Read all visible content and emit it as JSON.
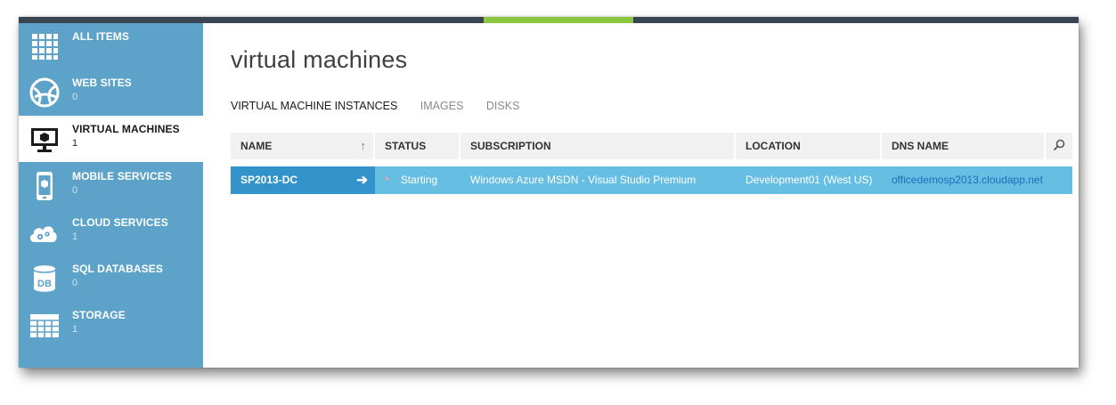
{
  "sidebar": {
    "items": [
      {
        "label": "ALL ITEMS",
        "count": "",
        "icon": "grid-icon"
      },
      {
        "label": "WEB SITES",
        "count": "0",
        "icon": "globe-icon"
      },
      {
        "label": "VIRTUAL MACHINES",
        "count": "1",
        "icon": "monitor-icon"
      },
      {
        "label": "MOBILE SERVICES",
        "count": "0",
        "icon": "phone-icon"
      },
      {
        "label": "CLOUD SERVICES",
        "count": "1",
        "icon": "cloud-gear-icon"
      },
      {
        "label": "SQL DATABASES",
        "count": "0",
        "icon": "database-icon"
      },
      {
        "label": "STORAGE",
        "count": "1",
        "icon": "table-icon"
      }
    ],
    "active_index": 2
  },
  "main": {
    "title": "virtual machines",
    "tabs": [
      {
        "label": "VIRTUAL MACHINE INSTANCES",
        "active": true
      },
      {
        "label": "IMAGES",
        "active": false
      },
      {
        "label": "DISKS",
        "active": false
      }
    ]
  },
  "grid": {
    "columns": [
      "NAME",
      "STATUS",
      "SUBSCRIPTION",
      "LOCATION",
      "DNS NAME"
    ],
    "sort_indicator": "↑",
    "rows": [
      {
        "name": "SP2013-DC",
        "status": "Starting",
        "subscription": "Windows Azure MSDN - Visual Studio Premium",
        "location": "Development01 (West US)",
        "dns_name": "officedemosp2013.cloudapp.net"
      }
    ]
  },
  "colors": {
    "sidebar_bg": "#5da3c9",
    "row_selected": "#67bee3",
    "row_name_cell": "#3193c9",
    "accent_green": "#8cc63e",
    "link": "#1c6fb5"
  }
}
